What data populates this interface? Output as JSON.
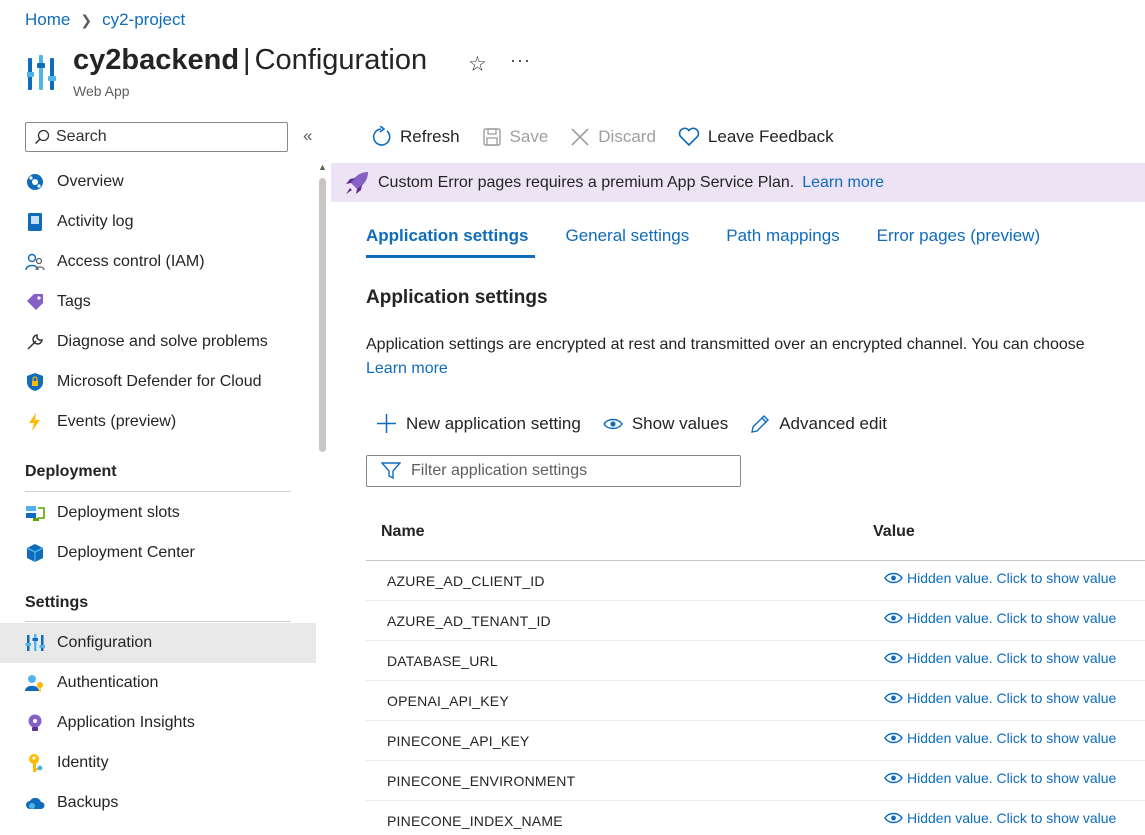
{
  "breadcrumb": {
    "home": "Home",
    "project": "cy2-project"
  },
  "header": {
    "app_name": "cy2backend",
    "separator": "|",
    "blade": "Configuration",
    "subtitle": "Web App",
    "more": "···"
  },
  "sidebar": {
    "search_placeholder": "Search",
    "collapse": "«",
    "top_items": [
      {
        "label": "Overview",
        "icon": "globe-icon"
      },
      {
        "label": "Activity log",
        "icon": "log-icon"
      },
      {
        "label": "Access control (IAM)",
        "icon": "people-icon"
      },
      {
        "label": "Tags",
        "icon": "tag-icon"
      },
      {
        "label": "Diagnose and solve problems",
        "icon": "wrench-icon"
      },
      {
        "label": "Microsoft Defender for Cloud",
        "icon": "shield-icon"
      },
      {
        "label": "Events (preview)",
        "icon": "lightning-icon"
      }
    ],
    "deployment_header": "Deployment",
    "deployment_items": [
      {
        "label": "Deployment slots",
        "icon": "slots-icon"
      },
      {
        "label": "Deployment Center",
        "icon": "cube-icon"
      }
    ],
    "settings_header": "Settings",
    "settings_items": [
      {
        "label": "Configuration",
        "icon": "configuration-icon",
        "selected": true
      },
      {
        "label": "Authentication",
        "icon": "person-key-icon"
      },
      {
        "label": "Application Insights",
        "icon": "lightbulb-icon"
      },
      {
        "label": "Identity",
        "icon": "key-icon"
      },
      {
        "label": "Backups",
        "icon": "cloud-icon"
      }
    ]
  },
  "toolbar": {
    "refresh": "Refresh",
    "save": "Save",
    "discard": "Discard",
    "feedback": "Leave Feedback"
  },
  "banner": {
    "text": "Custom Error pages requires a premium App Service Plan.",
    "link": "Learn more"
  },
  "tabs": [
    "Application settings",
    "General settings",
    "Path mappings",
    "Error pages (preview)"
  ],
  "main": {
    "section_title": "Application settings",
    "description": "Application settings are encrypted at rest and transmitted over an encrypted channel. You can choose",
    "learn_more": "Learn more",
    "new_setting": "New application setting",
    "show_values": "Show values",
    "advanced_edit": "Advanced edit",
    "filter_placeholder": "Filter application settings"
  },
  "table": {
    "columns": [
      "Name",
      "Value"
    ],
    "rows": [
      {
        "name": "AZURE_AD_CLIENT_ID",
        "value": "Hidden value. Click to show value"
      },
      {
        "name": "AZURE_AD_TENANT_ID",
        "value": "Hidden value. Click to show value"
      },
      {
        "name": "DATABASE_URL",
        "value": "Hidden value. Click to show value"
      },
      {
        "name": "OPENAI_API_KEY",
        "value": "Hidden value. Click to show value"
      },
      {
        "name": "PINECONE_API_KEY",
        "value": "Hidden value. Click to show value"
      },
      {
        "name": "PINECONE_ENVIRONMENT",
        "value": "Hidden value. Click to show value"
      },
      {
        "name": "PINECONE_INDEX_NAME",
        "value": "Hidden value. Click to show value"
      }
    ]
  },
  "colors": {
    "accent": "#0f6cbd",
    "banner_bg": "#ece3f5",
    "selected_bg": "#e9e9e9"
  }
}
